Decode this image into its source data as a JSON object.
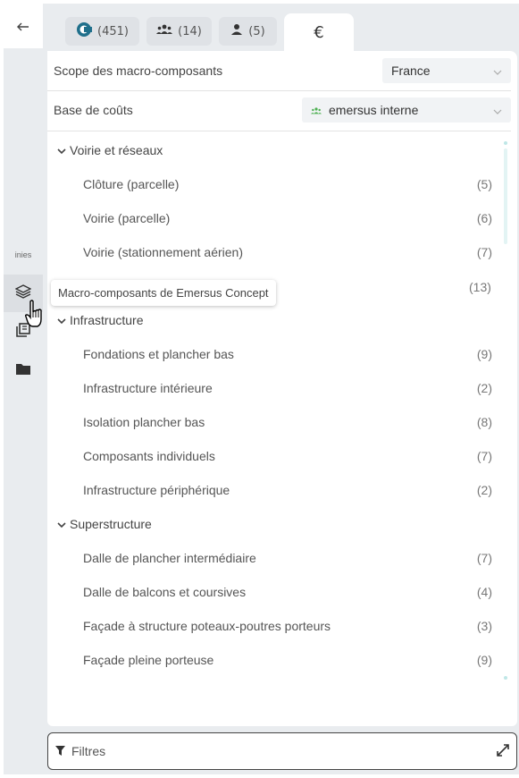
{
  "rail": {
    "back_icon": "arrow-left-icon",
    "inies_label": "inies",
    "items": [
      "layers-icon",
      "library-icon",
      "folder-icon"
    ]
  },
  "tabs": [
    {
      "icon": "logo-c-icon",
      "count": "(451)"
    },
    {
      "icon": "group-icon",
      "count": "(14)"
    },
    {
      "icon": "person-icon",
      "count": "(5)"
    },
    {
      "icon": "euro-icon",
      "label": "€"
    }
  ],
  "scope": {
    "label": "Scope des macro-composants",
    "value": "France"
  },
  "cost_base": {
    "label": "Base de coûts",
    "value": "emersus interne"
  },
  "tree": [
    {
      "type": "group",
      "label": "Voirie et réseaux"
    },
    {
      "type": "item",
      "label": "Clôture (parcelle)",
      "count": "(5)"
    },
    {
      "type": "item",
      "label": "Voirie (parcelle)",
      "count": "(6)"
    },
    {
      "type": "item",
      "label": "Voirie (stationnement aérien)",
      "count": "(7)"
    },
    {
      "type": "hidden",
      "label": "",
      "count": ""
    },
    {
      "type": "group",
      "label": "Infrastructure"
    },
    {
      "type": "item",
      "label": "Fondations et plancher bas",
      "count": "(9)"
    },
    {
      "type": "item",
      "label": "Infrastructure intérieure",
      "count": "(2)"
    },
    {
      "type": "item",
      "label": "Isolation plancher bas",
      "count": "(8)"
    },
    {
      "type": "item",
      "label": "Composants individuels",
      "count": "(7)"
    },
    {
      "type": "item",
      "label": "Infrastructure périphérique",
      "count": "(2)"
    },
    {
      "type": "group",
      "label": "Superstructure"
    },
    {
      "type": "item",
      "label": "Dalle de plancher intermédiaire",
      "count": "(7)"
    },
    {
      "type": "item",
      "label": "Dalle de balcons et coursives",
      "count": "(4)"
    },
    {
      "type": "item",
      "label": "Façade à structure poteaux-poutres porteurs",
      "count": "(3)"
    },
    {
      "type": "item",
      "label": "Façade pleine porteuse",
      "count": "(9)"
    }
  ],
  "tooltip": {
    "text": "Macro-composants de Emersus Concept",
    "count": "(13)"
  },
  "filters": {
    "label": "Filtres"
  },
  "colors": {
    "accent": "#1f7a8c",
    "group_icon": "#4caf50"
  }
}
